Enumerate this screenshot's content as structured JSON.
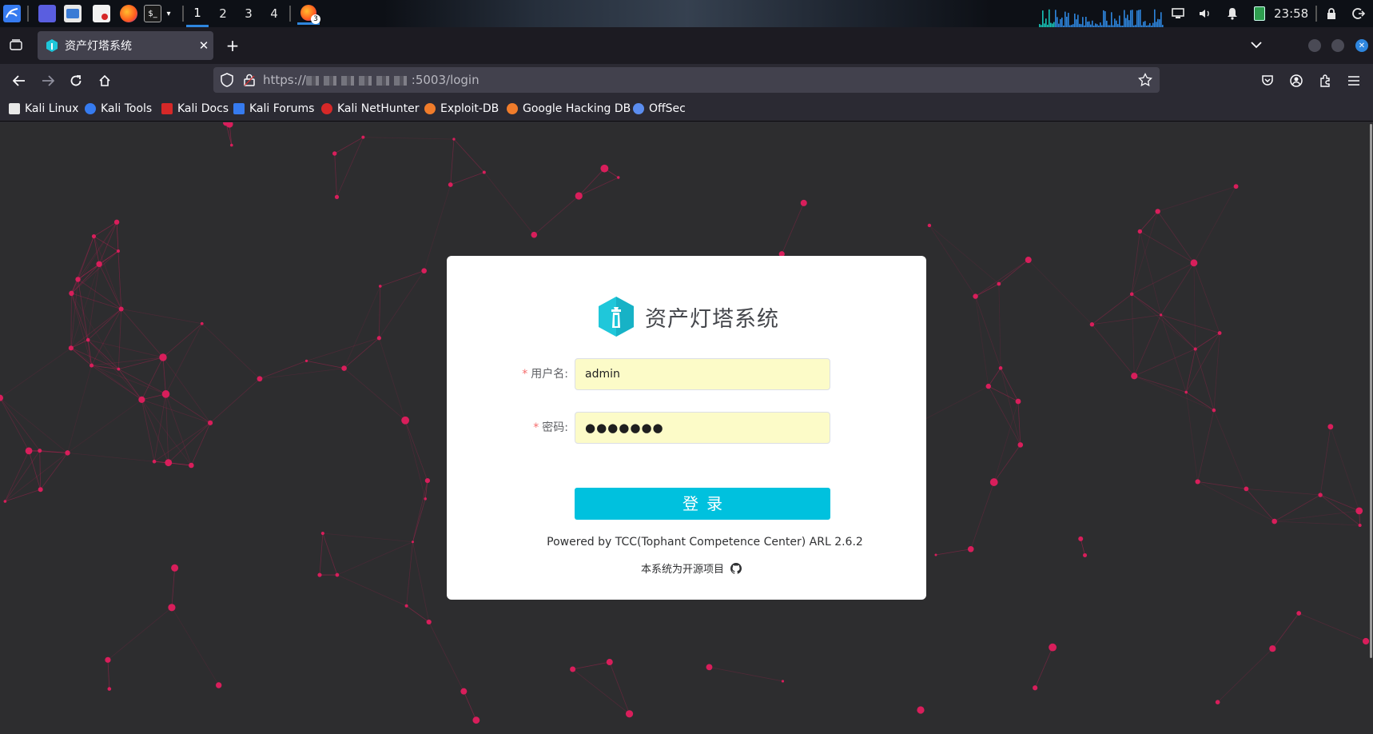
{
  "panel": {
    "workspaces": [
      "1",
      "2",
      "3",
      "4"
    ],
    "active_workspace": "1",
    "firefox_badge": "3",
    "clock": "23:58"
  },
  "browser": {
    "tab_title": "资产灯塔系统",
    "url": "https://",
    "url_suffix": ":5003/login",
    "bookmarks": [
      {
        "label": "Kali Linux",
        "color": "#e8e8e8"
      },
      {
        "label": "Kali Tools",
        "color": "#367bf0"
      },
      {
        "label": "Kali Docs",
        "color": "#d62828"
      },
      {
        "label": "Kali Forums",
        "color": "#367bf0"
      },
      {
        "label": "Kali NetHunter",
        "color": "#d62828"
      },
      {
        "label": "Exploit-DB",
        "color": "#f07c2b"
      },
      {
        "label": "Google Hacking DB",
        "color": "#f07c2b"
      },
      {
        "label": "OffSec",
        "color": "#5b8def"
      }
    ]
  },
  "login": {
    "brand_name": "资产灯塔系统",
    "username_label": "用户名:",
    "username_value": "admin",
    "password_label": "密码:",
    "password_value": "●●●●●●●",
    "submit_label": "登录",
    "powered_by": "Powered by TCC(Tophant Competence Center) ARL 2.6.2",
    "open_source_text": "本系统为开源项目"
  },
  "colors": {
    "accent": "#00c1de",
    "required": "#f56c6c",
    "autofill": "#fcfbc8",
    "particle": "#d81e5b",
    "page_bg": "#2d2d2f"
  },
  "icons": {
    "back": "arrow-left-icon",
    "forward": "arrow-right-icon",
    "reload": "reload-icon",
    "home": "home-icon",
    "github": "github-icon"
  }
}
